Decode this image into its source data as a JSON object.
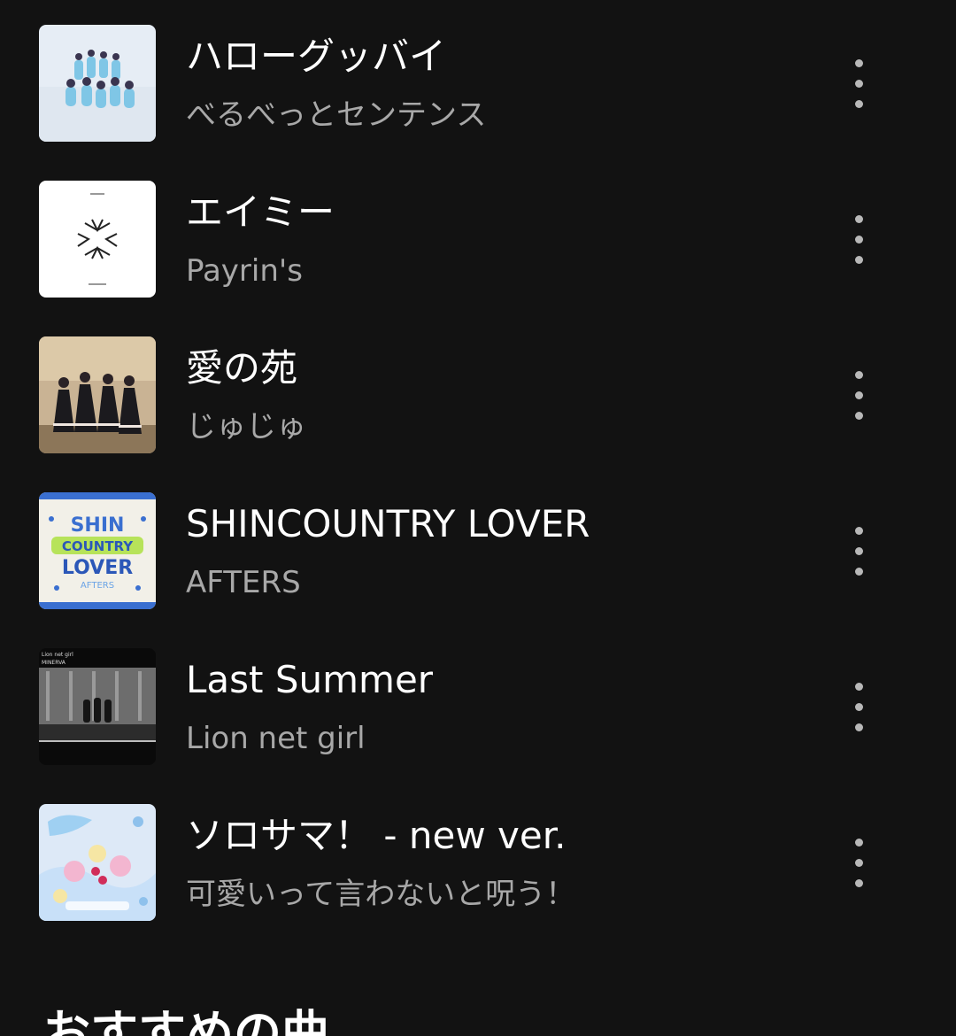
{
  "tracks": [
    {
      "title": "ハローグッバイ",
      "artist": "べるべっとセンテンス",
      "cover_icon": "album-cover-idol-group-light-blue"
    },
    {
      "title": "エイミー",
      "artist": "Payrin's",
      "cover_icon": "album-cover-white-logo"
    },
    {
      "title": "愛の苑",
      "artist": "じゅじゅ",
      "cover_icon": "album-cover-gothic-dresses"
    },
    {
      "title": "SHINCOUNTRY LOVER",
      "artist": "AFTERS",
      "cover_icon": "album-cover-shincountry-lover-logo"
    },
    {
      "title": "Last Summer",
      "artist": "Lion net girl",
      "cover_icon": "album-cover-monochrome-station"
    },
    {
      "title": "ソロサマ！ - new ver.",
      "artist": "可愛いって言わないと呪う！",
      "cover_icon": "album-cover-pastel-collage"
    }
  ],
  "more_icon": "more-vertical-icon",
  "section": {
    "heading": "おすすめの曲"
  },
  "cover_texts": {
    "shincountry": [
      "SHIN",
      "COUNTRY",
      "LOVER",
      "AFTERS"
    ],
    "lastsummer": [
      "Lion net girl",
      "MINERVA"
    ]
  },
  "colors": {
    "background": "#121212",
    "title": "#ffffff",
    "artist": "#a8a8a8",
    "dots": "#b8b8b8"
  }
}
